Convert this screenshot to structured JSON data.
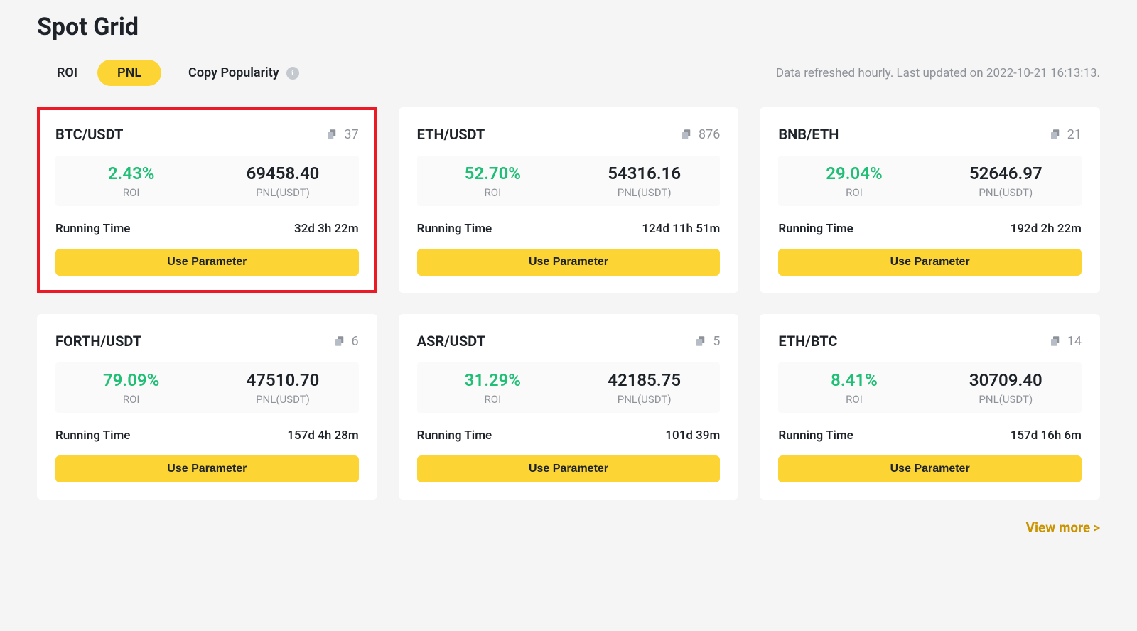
{
  "title": "Spot Grid",
  "tabs": {
    "roi": "ROI",
    "pnl": "PNL",
    "copy": "Copy Popularity"
  },
  "active_tab": "pnl",
  "refreshed": "Data refreshed hourly. Last updated on 2022-10-21 16:13:13.",
  "labels": {
    "roi": "ROI",
    "pnl": "PNL(USDT)",
    "running": "Running Time",
    "use": "Use Parameter",
    "view_more": "View more"
  },
  "cards": [
    {
      "pair": "BTC/USDT",
      "copies": "37",
      "roi": "2.43%",
      "pnl": "69458.40",
      "running": "32d 3h 22m",
      "highlight": true
    },
    {
      "pair": "ETH/USDT",
      "copies": "876",
      "roi": "52.70%",
      "pnl": "54316.16",
      "running": "124d 11h 51m",
      "highlight": false
    },
    {
      "pair": "BNB/ETH",
      "copies": "21",
      "roi": "29.04%",
      "pnl": "52646.97",
      "running": "192d 2h 22m",
      "highlight": false
    },
    {
      "pair": "FORTH/USDT",
      "copies": "6",
      "roi": "79.09%",
      "pnl": "47510.70",
      "running": "157d 4h 28m",
      "highlight": false
    },
    {
      "pair": "ASR/USDT",
      "copies": "5",
      "roi": "31.29%",
      "pnl": "42185.75",
      "running": "101d 39m",
      "highlight": false
    },
    {
      "pair": "ETH/BTC",
      "copies": "14",
      "roi": "8.41%",
      "pnl": "30709.40",
      "running": "157d 16h 6m",
      "highlight": false
    }
  ]
}
